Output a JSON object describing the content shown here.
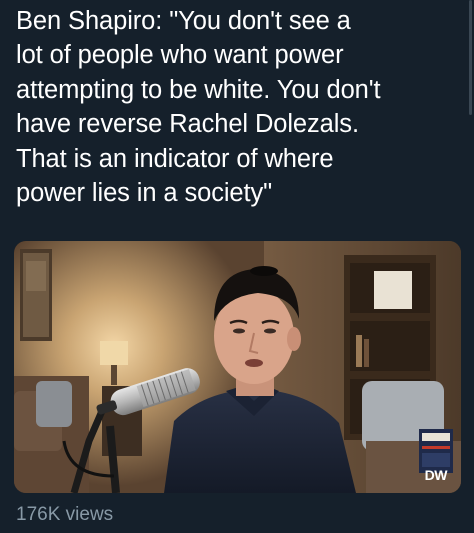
{
  "tweet": {
    "lines": [
      "Ben Shapiro: \"You don't see a",
      "lot of people who want power",
      "attempting to be white. You don't",
      "have reverse Rachel Dolezals.",
      "That is an indicator of where",
      "power lies in a society\""
    ]
  },
  "video": {
    "watermark": "DW"
  },
  "stats": {
    "views": "176K views"
  },
  "colors": {
    "background": "#15202b",
    "text": "#ffffff",
    "secondary_text": "#8899a6"
  }
}
